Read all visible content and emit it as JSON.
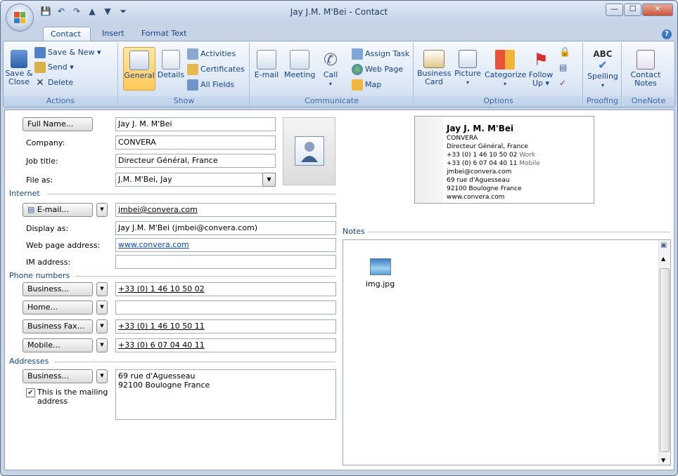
{
  "window": {
    "title": "Jay J.M. M'Bei - Contact"
  },
  "tabs": [
    "Contact",
    "Insert",
    "Format Text"
  ],
  "ribbon": {
    "actions": {
      "save_close": "Save &\nClose",
      "save_new": "Save & New ▾",
      "send": "Send ▾",
      "delete": "Delete",
      "label": "Actions"
    },
    "show": {
      "general": "General",
      "details": "Details",
      "activities": "Activities",
      "certificates": "Certificates",
      "all_fields": "All Fields",
      "label": "Show"
    },
    "communicate": {
      "email": "E-mail",
      "meeting": "Meeting",
      "call": "Call",
      "call_arrow": "▾",
      "assign_task": "Assign Task",
      "web_page": "Web Page",
      "map": "Map",
      "label": "Communicate"
    },
    "options": {
      "business": "Business",
      "card": "Card",
      "picture": "Picture",
      "picture_arrow": "▾",
      "categorize": "Categorize",
      "categorize_arrow": "▾",
      "follow": "Follow",
      "up": "Up ▾",
      "label": "Options"
    },
    "proofing": {
      "spelling": "Spelling",
      "spelling_arrow": "▾",
      "abc": "ABC",
      "label": "Proofing"
    },
    "onenote": {
      "contact": "Contact",
      "notes": "Notes",
      "label": "OneNote"
    }
  },
  "form": {
    "full_name_btn": "Full Name...",
    "full_name": "Jay J. M. M'Bei",
    "company_label": "Company:",
    "company": "CONVERA",
    "job_title_label": "Job title:",
    "job_title": "Directeur Général, France",
    "file_as_label": "File as:",
    "file_as": "J.M. M'Bei, Jay",
    "internet_label": "Internet",
    "email_btn": "E-mail...",
    "email": "jmbei@convera.com",
    "display_as_label": "Display as:",
    "display_as": "Jay J.M. M'Bei (jmbei@convera.com)",
    "web_label": "Web page address:",
    "web": "www.convera.com",
    "im_label": "IM address:",
    "im": "",
    "phones_label": "Phone numbers",
    "phones": [
      {
        "type": "Business...",
        "value": "+33 (0) 1 46 10 50 02"
      },
      {
        "type": "Home...",
        "value": ""
      },
      {
        "type": "Business Fax...",
        "value": "+33 (0) 1 46 10 50 11"
      },
      {
        "type": "Mobile...",
        "value": "+33 (0) 6 07 04 40 11"
      }
    ],
    "addresses_label": "Addresses",
    "address_type": "Business...",
    "address_line1": "69 rue d'Aguesseau",
    "address_line2": "92100  Boulogne France",
    "mailing_checkbox": "This is the mailing address",
    "mailing_checked": true
  },
  "business_card": {
    "name": "Jay J. M. M'Bei",
    "company": "CONVERA",
    "title": "Directeur Général, France",
    "work_phone": "+33 (0) 1 46 10 50 02",
    "work_label": "Work",
    "mobile_phone": "+33 (0) 6 07 04 40 11",
    "mobile_label": "Mobile",
    "email": "jmbei@convera.com",
    "street": "69 rue d'Aguesseau",
    "city": "92100  Boulogne France",
    "web": "www.convera.com"
  },
  "notes": {
    "label": "Notes",
    "attachment": "img.jpg"
  },
  "colors": {
    "accent": "#15428b",
    "ribbon_bg": "#dbe6f4",
    "selected": "#ffc95a"
  }
}
